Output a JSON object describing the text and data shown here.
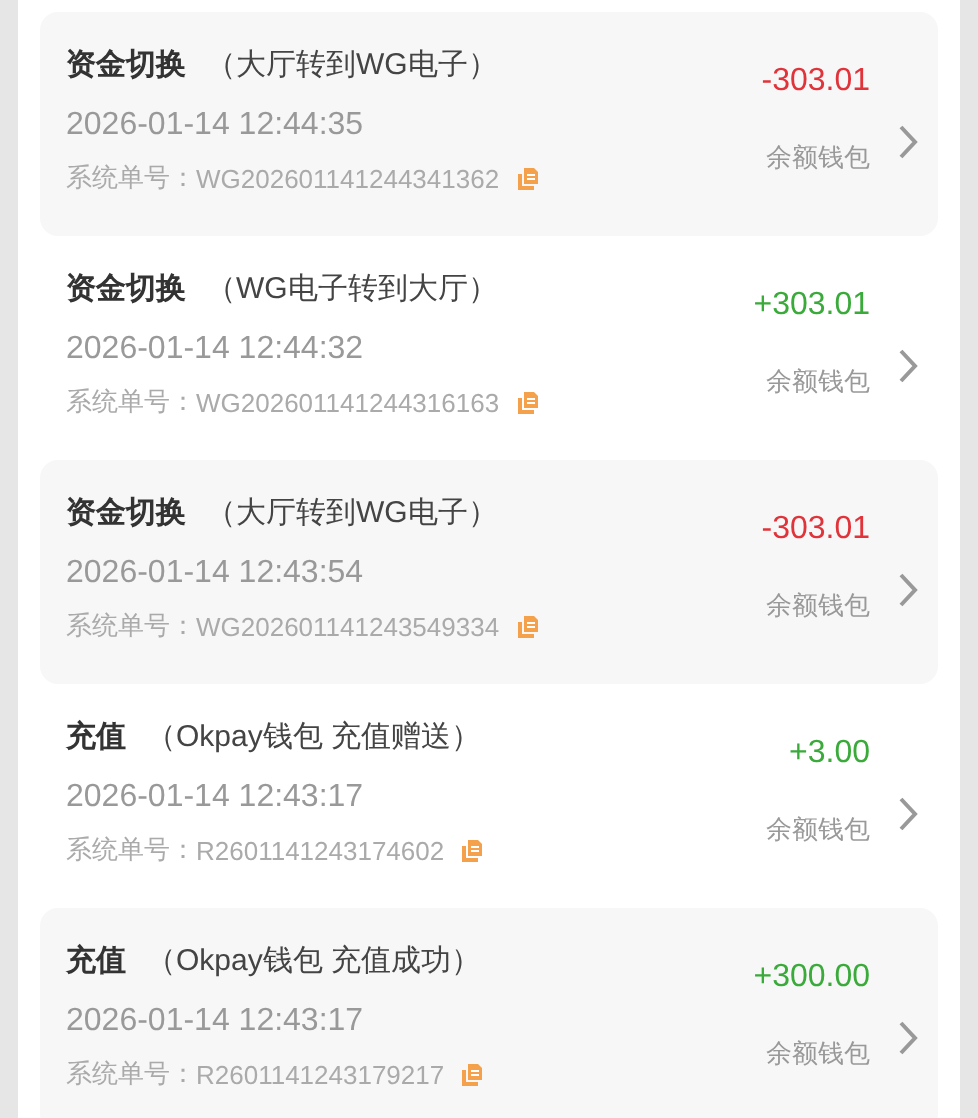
{
  "records": [
    {
      "type": "资金切换",
      "detail": "（大厅转到WG电子）",
      "time": "2026-01-14 12:44:35",
      "order_label": "系统单号：",
      "order_no": "WG202601141244341362",
      "kind": "debit",
      "amount": "-303.01",
      "wallet": "余额钱包"
    },
    {
      "type": "资金切换",
      "detail": "（WG电子转到大厅）",
      "time": "2026-01-14 12:44:32",
      "order_label": "系统单号：",
      "order_no": "WG202601141244316163",
      "kind": "credit",
      "amount": "+303.01",
      "wallet": "余额钱包"
    },
    {
      "type": "资金切换",
      "detail": "（大厅转到WG电子）",
      "time": "2026-01-14 12:43:54",
      "order_label": "系统单号：",
      "order_no": "WG202601141243549334",
      "kind": "debit",
      "amount": "-303.01",
      "wallet": "余额钱包"
    },
    {
      "type": "充值",
      "detail": "（Okpay钱包 充值赠送）",
      "time": "2026-01-14 12:43:17",
      "order_label": "系统单号：",
      "order_no": "R2601141243174602",
      "kind": "credit",
      "amount": "+3.00",
      "wallet": "余额钱包"
    },
    {
      "type": "充值",
      "detail": "（Okpay钱包 充值成功）",
      "time": "2026-01-14 12:43:17",
      "order_label": "系统单号：",
      "order_no": "R2601141243179217",
      "kind": "credit",
      "amount": "+300.00",
      "wallet": "余额钱包"
    }
  ]
}
